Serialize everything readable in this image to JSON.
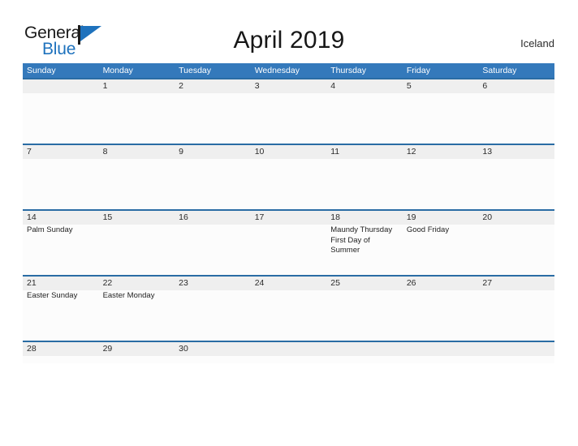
{
  "brand": {
    "name_part1": "General",
    "name_part2": "Blue",
    "accent_color": "#1e72bd",
    "flag_icon": "flag-triangle-icon"
  },
  "header": {
    "title": "April 2019",
    "region": "Iceland"
  },
  "calendar": {
    "month": "April",
    "year": "2019",
    "header_color": "#3479bb",
    "separator_color": "#2a6ca4",
    "number_band_color": "#efefef",
    "day_names": [
      "Sunday",
      "Monday",
      "Tuesday",
      "Wednesday",
      "Thursday",
      "Friday",
      "Saturday"
    ],
    "weeks": [
      {
        "days": [
          {
            "num": "",
            "events": ""
          },
          {
            "num": "1",
            "events": ""
          },
          {
            "num": "2",
            "events": ""
          },
          {
            "num": "3",
            "events": ""
          },
          {
            "num": "4",
            "events": ""
          },
          {
            "num": "5",
            "events": ""
          },
          {
            "num": "6",
            "events": ""
          }
        ]
      },
      {
        "days": [
          {
            "num": "7",
            "events": ""
          },
          {
            "num": "8",
            "events": ""
          },
          {
            "num": "9",
            "events": ""
          },
          {
            "num": "10",
            "events": ""
          },
          {
            "num": "11",
            "events": ""
          },
          {
            "num": "12",
            "events": ""
          },
          {
            "num": "13",
            "events": ""
          }
        ]
      },
      {
        "days": [
          {
            "num": "14",
            "events": "Palm Sunday"
          },
          {
            "num": "15",
            "events": ""
          },
          {
            "num": "16",
            "events": ""
          },
          {
            "num": "17",
            "events": ""
          },
          {
            "num": "18",
            "events": "Maundy Thursday  First Day of Summer"
          },
          {
            "num": "19",
            "events": "Good Friday"
          },
          {
            "num": "20",
            "events": ""
          }
        ]
      },
      {
        "days": [
          {
            "num": "21",
            "events": "Easter Sunday"
          },
          {
            "num": "22",
            "events": "Easter Monday"
          },
          {
            "num": "23",
            "events": ""
          },
          {
            "num": "24",
            "events": ""
          },
          {
            "num": "25",
            "events": ""
          },
          {
            "num": "26",
            "events": ""
          },
          {
            "num": "27",
            "events": ""
          }
        ]
      },
      {
        "days": [
          {
            "num": "28",
            "events": ""
          },
          {
            "num": "29",
            "events": ""
          },
          {
            "num": "30",
            "events": ""
          },
          {
            "num": "",
            "events": ""
          },
          {
            "num": "",
            "events": ""
          },
          {
            "num": "",
            "events": ""
          },
          {
            "num": "",
            "events": ""
          }
        ]
      }
    ]
  }
}
